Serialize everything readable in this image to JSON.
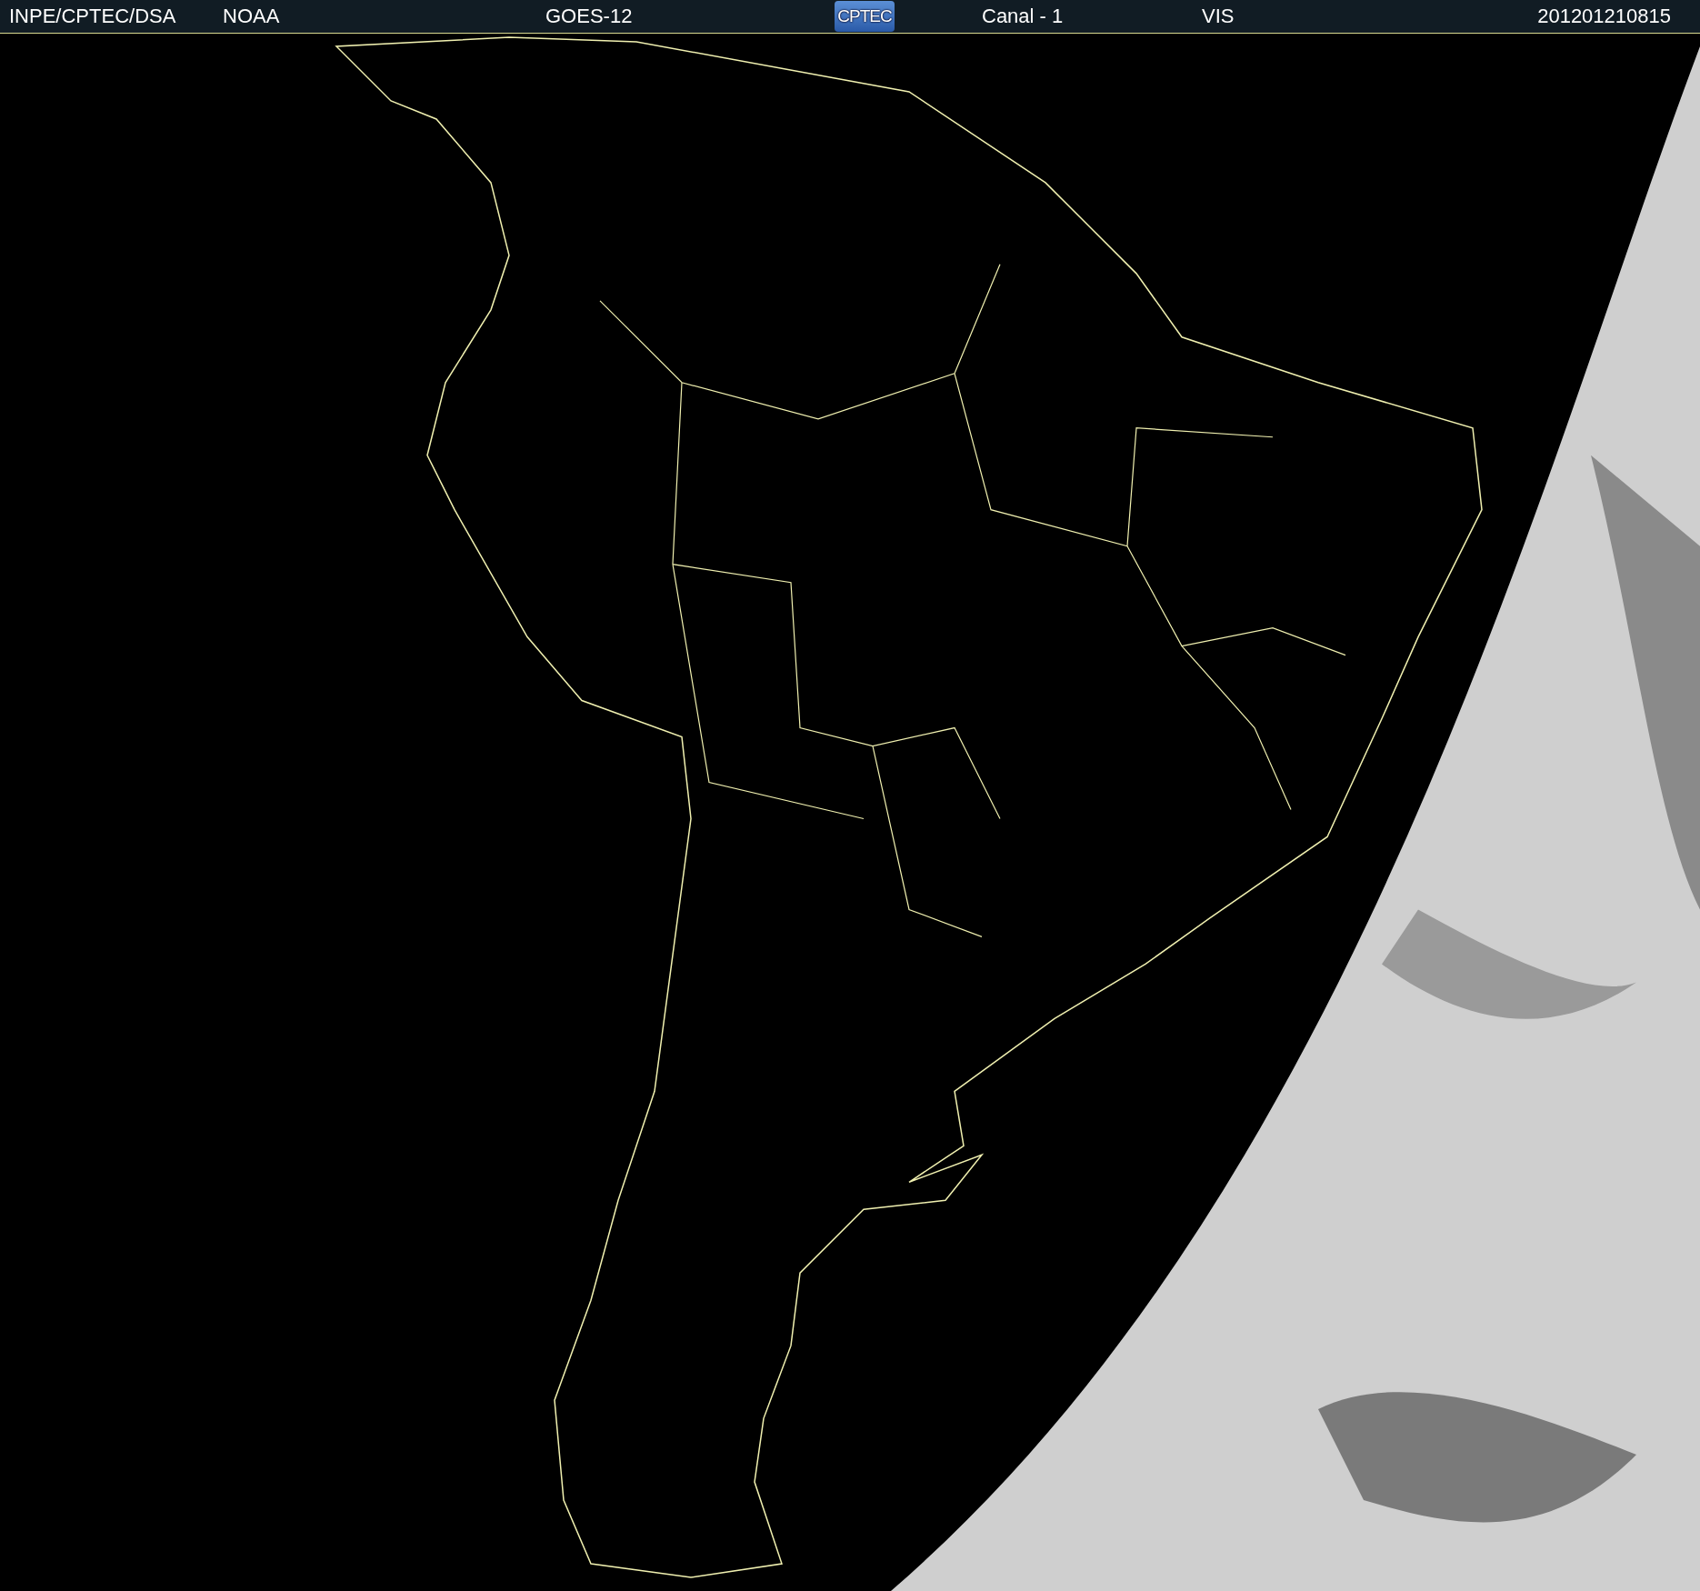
{
  "header": {
    "items": [
      {
        "kind": "text",
        "label": "INPE/CPTEC/DSA"
      },
      {
        "kind": "text",
        "label": "NOAA"
      },
      {
        "kind": "text",
        "label": "GOES-12"
      },
      {
        "kind": "logo",
        "label": "CPTEC"
      },
      {
        "kind": "text",
        "label": "Canal - 1"
      },
      {
        "kind": "text",
        "label": "VIS"
      },
      {
        "kind": "text",
        "label": "201201210815"
      }
    ]
  }
}
